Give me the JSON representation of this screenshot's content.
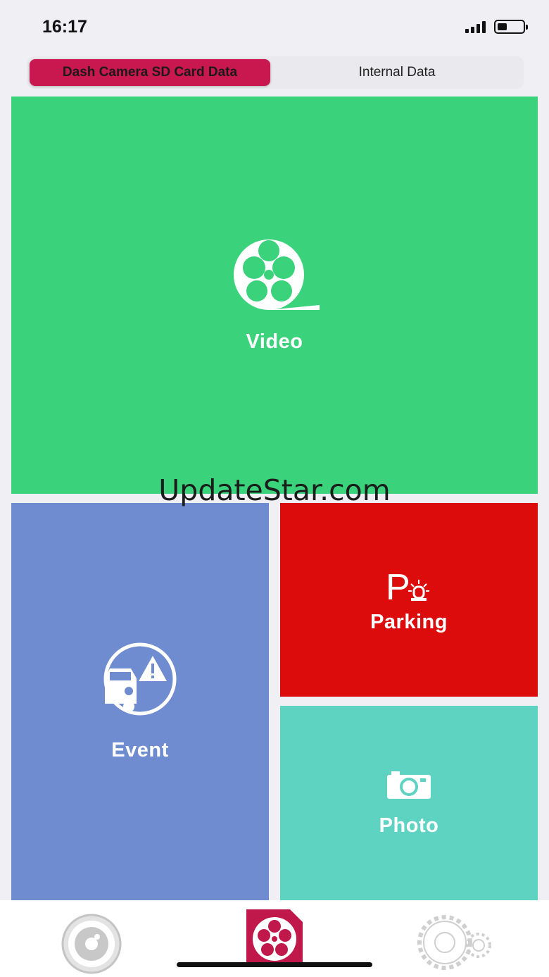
{
  "status_bar": {
    "time": "16:17",
    "battery_level": 0.35
  },
  "segmented_control": {
    "active_label": "Dash Camera SD Card Data",
    "inactive_label": "Internal Data"
  },
  "tiles": {
    "video": {
      "label": "Video",
      "icon": "film-reel-icon",
      "color": "#3ad37c"
    },
    "event": {
      "label": "Event",
      "icon": "car-warning-icon",
      "color": "#6e8ccf"
    },
    "parking": {
      "label": "Parking",
      "icon": "parking-alarm-icon",
      "color": "#dc0c0c"
    },
    "photo": {
      "label": "Photo",
      "icon": "camera-icon",
      "color": "#5fd3c2"
    }
  },
  "watermark": "UpdateStar.com",
  "tab_bar": {
    "items": [
      {
        "icon": "camera-lens-icon",
        "selected": false
      },
      {
        "icon": "film-reel-icon",
        "selected": true,
        "color": "#c0184a"
      },
      {
        "icon": "settings-gear-icon",
        "selected": false
      }
    ]
  }
}
